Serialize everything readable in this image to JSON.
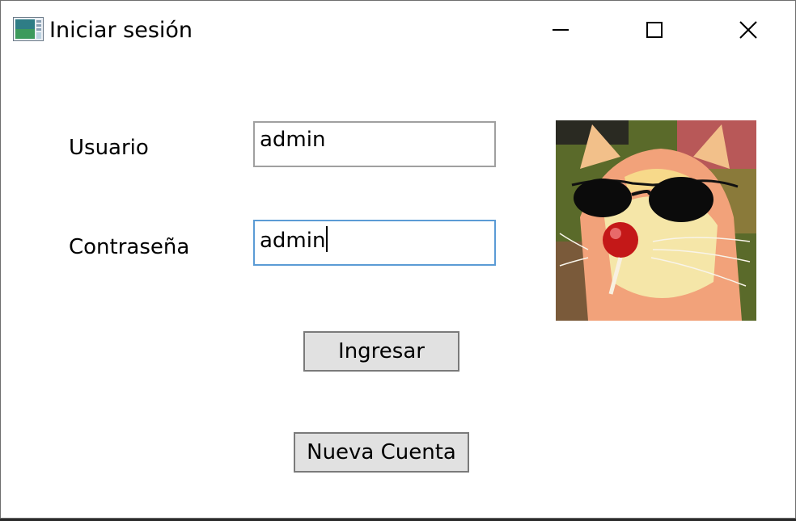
{
  "window": {
    "title": "Iniciar sesión",
    "icons": {
      "app": "app-window-icon",
      "minimize": "minimize-icon",
      "maximize": "maximize-icon",
      "close": "close-icon"
    }
  },
  "form": {
    "user_label": "Usuario",
    "user_value": "admin",
    "password_label": "Contraseña",
    "password_value": "admin",
    "login_button": "Ingresar",
    "new_account_button": "Nueva Cuenta"
  },
  "image": {
    "subject": "cat-with-sunglasses-and-lollipop"
  },
  "colors": {
    "focus_border": "#5b9bd5",
    "field_border": "#a0a0a0",
    "button_bg": "#e1e1e1"
  }
}
